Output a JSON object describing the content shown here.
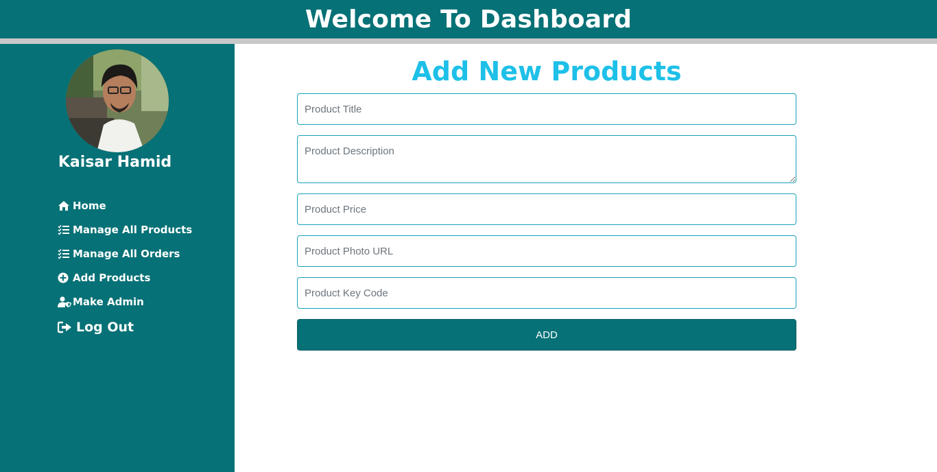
{
  "header": {
    "title": "Welcome To Dashboard"
  },
  "sidebar": {
    "profile_name": "Kaisar Hamid",
    "items": [
      {
        "label": "Home",
        "icon": "home-icon"
      },
      {
        "label": "Manage All Products",
        "icon": "checklist-icon"
      },
      {
        "label": "Manage All Orders",
        "icon": "checklist-icon"
      },
      {
        "label": "Add Products",
        "icon": "plus-circle-icon"
      },
      {
        "label": "Make Admin",
        "icon": "user-shield-icon"
      }
    ],
    "logout_label": "Log Out"
  },
  "main": {
    "title": "Add New Products",
    "fields": {
      "title_placeholder": "Product Title",
      "description_placeholder": "Product Description",
      "price_placeholder": "Product Price",
      "photo_placeholder": "Product Photo URL",
      "key_placeholder": "Product Key Code"
    },
    "submit_label": "ADD"
  },
  "colors": {
    "primary": "#067176",
    "title_accent": "#1ec0e8",
    "divider": "#c8c8c8",
    "field_border": "#17a2b8"
  }
}
